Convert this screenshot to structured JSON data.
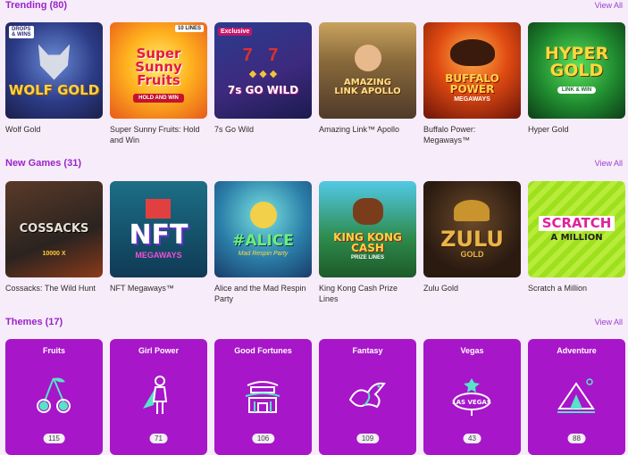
{
  "sections": {
    "trending": {
      "title": "Trending (80)",
      "view_all": "View All"
    },
    "new_games": {
      "title": "New Games (31)",
      "view_all": "View All"
    },
    "themes": {
      "title": "Themes (17)",
      "view_all": "View All"
    }
  },
  "trending": [
    {
      "name": "Wolf Gold",
      "logo": "WOLF GOLD",
      "badge": "DROPS & WINS"
    },
    {
      "name": "Super Sunny Fruits: Hold and Win",
      "logo": "Super Sunny Fruits",
      "sub": "HOLD AND WIN",
      "badge": "10 LINES"
    },
    {
      "name": "7s Go Wild",
      "logo": "7s GO WILD",
      "badge": "Exclusive"
    },
    {
      "name": "Amazing Link™ Apollo",
      "logo": "AMAZING LINK APOLLO"
    },
    {
      "name": "Buffalo Power: Megaways™",
      "logo": "BUFFALO POWER",
      "sub": "MEGAWAYS"
    },
    {
      "name": "Hyper Gold",
      "logo": "HYPER GOLD",
      "sub": "LINK & WIN"
    }
  ],
  "new_games": [
    {
      "name": "Cossacks: The Wild Hunt",
      "logo": "COSSACKS",
      "sub": "10000 X"
    },
    {
      "name": "NFT Megaways™",
      "logo": "NFT",
      "sub": "MEGAWAYS"
    },
    {
      "name": "Alice and the Mad Respin Party",
      "logo": "#ALICE",
      "sub": "Mad Respin Party"
    },
    {
      "name": "King Kong Cash Prize Lines",
      "logo": "KING KONG CASH",
      "sub": "PRIZE LINES"
    },
    {
      "name": "Zulu Gold",
      "logo": "ZULU",
      "sub": "GOLD"
    },
    {
      "name": "Scratch a Million",
      "logo": "SCRATCH",
      "sub": "A MILLION"
    }
  ],
  "themes": [
    {
      "name": "Fruits",
      "count": "115",
      "icon": "cherry-icon"
    },
    {
      "name": "Girl Power",
      "count": "71",
      "icon": "superhero-girl-icon"
    },
    {
      "name": "Good Fortunes",
      "count": "106",
      "icon": "temple-gate-icon"
    },
    {
      "name": "Fantasy",
      "count": "109",
      "icon": "dragon-icon"
    },
    {
      "name": "Vegas",
      "count": "43",
      "icon": "las-vegas-sign-icon"
    },
    {
      "name": "Adventure",
      "count": "88",
      "icon": "tent-icon"
    }
  ],
  "colors": {
    "background": "#f7ecf9",
    "accent": "#9a24c9",
    "theme_card": "#a716c9",
    "icon_teal": "#58e3c8"
  }
}
